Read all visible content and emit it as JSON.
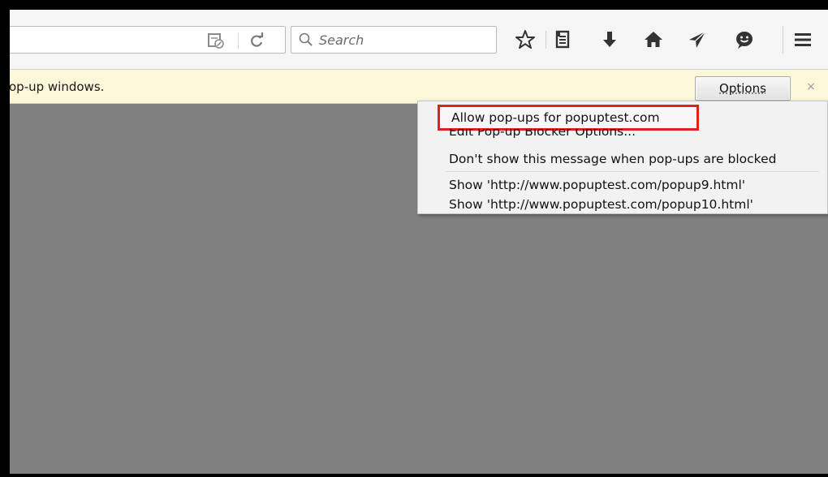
{
  "toolbar": {
    "search_placeholder": "Search",
    "icons": [
      "reader-view-icon",
      "reload-icon",
      "search-icon",
      "bookmark-star-icon",
      "bookmarks-list-icon",
      "download-arrow-icon",
      "home-icon",
      "send-icon",
      "chat-smiley-icon",
      "hamburger-menu-icon"
    ]
  },
  "notification": {
    "message": "op-up windows.",
    "options_label": "Options",
    "close_glyph": "×"
  },
  "menu": {
    "items": [
      "Allow pop-ups for popuptest.com",
      "Edit Pop-up Blocker Options...",
      "Don't show this message when pop-ups are blocked",
      "Show 'http://www.popuptest.com/popup9.html'",
      "Show 'http://www.popuptest.com/popup10.html'"
    ]
  },
  "colors": {
    "highlight_box": "#e3211c",
    "notification_bg": "#fcf7d9",
    "content_bg": "#808080"
  }
}
